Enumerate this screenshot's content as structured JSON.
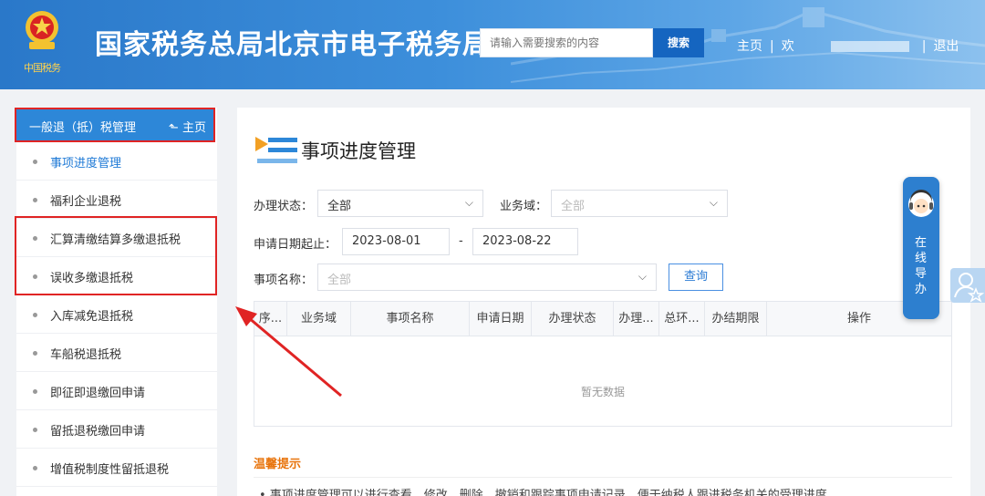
{
  "header": {
    "title": "国家税务总局北京市电子税务局",
    "emblem_subtitle": "中国税务",
    "search_placeholder": "请输入需要搜索的内容",
    "search_button": "搜索",
    "nav_home": "主页",
    "nav_welcome": "欢",
    "nav_logout": "退出"
  },
  "sidebar": {
    "heading": "一般退（抵）税管理",
    "home_link": "主页",
    "items": [
      {
        "label": "事项进度管理",
        "active": true
      },
      {
        "label": "福利企业退税",
        "active": false
      },
      {
        "label": "汇算清缴结算多缴退抵税",
        "active": false
      },
      {
        "label": "误收多缴退抵税",
        "active": false
      },
      {
        "label": "入库减免退抵税",
        "active": false
      },
      {
        "label": "车船税退抵税",
        "active": false
      },
      {
        "label": "即征即退缴回申请",
        "active": false
      },
      {
        "label": "留抵退税缴回申请",
        "active": false
      },
      {
        "label": "增值税制度性留抵退税",
        "active": false
      }
    ]
  },
  "main": {
    "title": "事项进度管理",
    "filters": {
      "status_label": "办理状态：",
      "status_value": "全部",
      "domain_label": "业务域：",
      "domain_placeholder": "全部",
      "date_label": "申请日期起止：",
      "date_from": "2023-08-01",
      "date_sep": "-",
      "date_to": "2023-08-22",
      "item_label": "事项名称：",
      "item_placeholder": "全部",
      "query_button": "查询"
    },
    "table": {
      "columns": [
        "序...",
        "业务域",
        "事项名称",
        "申请日期",
        "办理状态",
        "办理...",
        "总环...",
        "办结期限",
        "操作"
      ],
      "empty_text": "暂无数据"
    },
    "tips": {
      "title": "温馨提示",
      "text": "• 事项进度管理可以进行查看、修改、删除、撤销和跟踪事项申请记录，便于纳税人跟进税务机关的受理进度"
    }
  },
  "guide": {
    "label": "在线导办"
  },
  "colors": {
    "brand_blue": "#2d87d8",
    "highlight_red": "#e02424",
    "tips_orange": "#e8740c"
  }
}
